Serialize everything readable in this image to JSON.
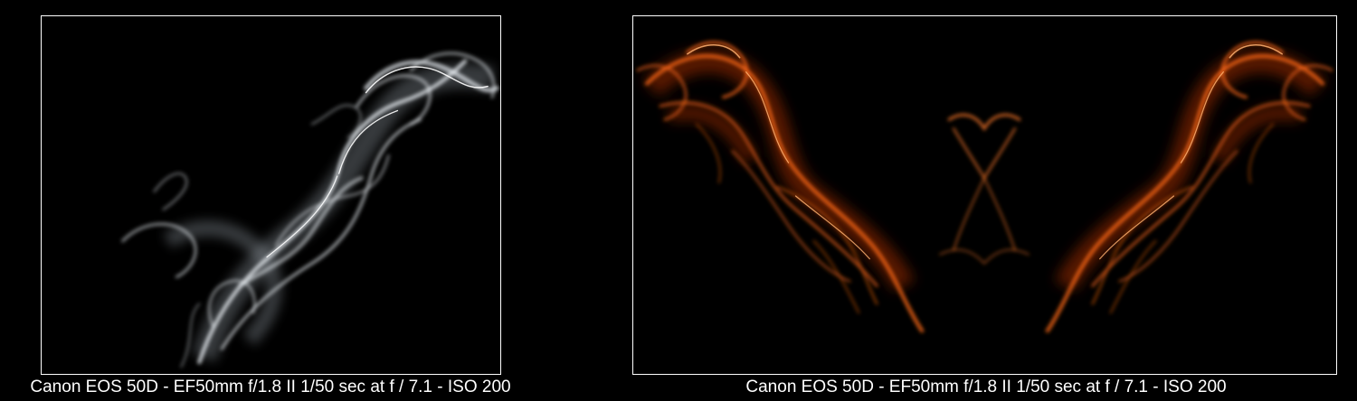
{
  "photos": [
    {
      "caption": "Canon EOS 50D - EF50mm f/1.8 II 1/50 sec at f / 7.1 - ISO 200",
      "subject": "white smoke on black background",
      "smoke_color": "#e8eef4"
    },
    {
      "caption": "Canon EOS 50D - EF50mm f/1.8 II 1/50 sec at f / 7.1 - ISO 200",
      "subject": "mirrored orange smoke on black background",
      "smoke_color": "#ff6a1a"
    }
  ],
  "colors": {
    "background": "#000000",
    "frame_border": "#ffffff",
    "caption_text": "#ffffff"
  }
}
